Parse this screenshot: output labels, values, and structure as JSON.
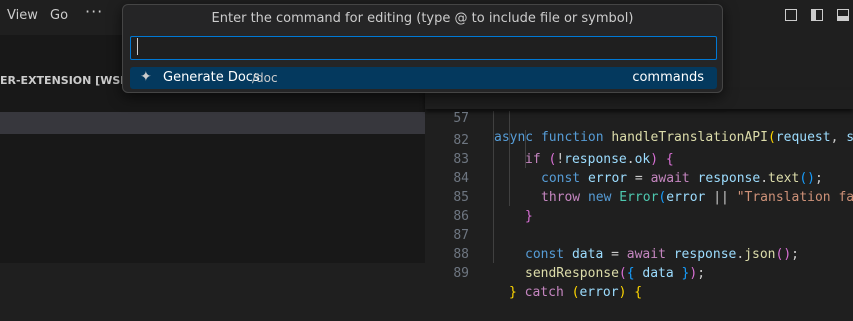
{
  "menu": {
    "view": "View",
    "go": "Go",
    "more": "···"
  },
  "explorer": {
    "title": "ER-EXTENSION [WSL: UB"
  },
  "palette": {
    "title": "Enter the command for editing (type @ to include file or symbol)",
    "input_value": "",
    "items": [
      {
        "icon": "sparkle-icon",
        "label": "Generate Docs",
        "description": "/doc",
        "category": "commands"
      }
    ]
  },
  "editor": {
    "sticky": {
      "number": "57"
    },
    "lines": [
      {
        "number": "82"
      },
      {
        "number": "83"
      },
      {
        "number": "84"
      },
      {
        "number": "85"
      },
      {
        "number": "86"
      },
      {
        "number": "87"
      },
      {
        "number": "88"
      },
      {
        "number": "89"
      }
    ]
  },
  "colors": {
    "accent": "#0078d4",
    "selection": "#04395e",
    "background": "#1f1f1f"
  }
}
